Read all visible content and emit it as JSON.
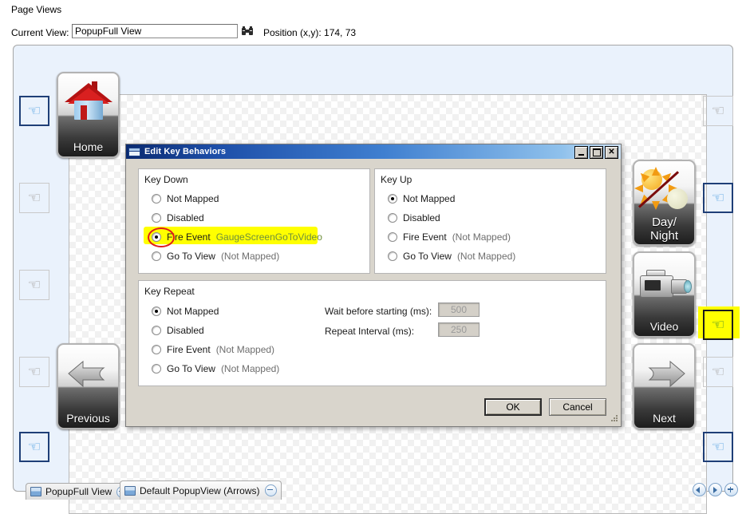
{
  "header": {
    "section_title": "Page Views",
    "current_view_label": "Current View:",
    "current_view_value": "PopupFull View",
    "current_view_placeholder": "",
    "binoculars_icon": "binoculars-icon",
    "position_label": "Position (x,y): 174, 73"
  },
  "canvas_buttons": {
    "home": {
      "label": "Home",
      "icon": "house-icon"
    },
    "previous": {
      "label": "Previous",
      "icon": "arrow-left-icon"
    },
    "day_night": {
      "label_line1": "Day/",
      "label_line2": "Night",
      "icon": "sun-moon-icon"
    },
    "video": {
      "label": "Video",
      "icon": "camcorder-icon"
    },
    "next": {
      "label": "Next",
      "icon": "arrow-right-icon"
    }
  },
  "hotspots": {
    "icon": "hand-pointer-icon",
    "left": [
      {
        "state": "selected"
      },
      {
        "state": "normal"
      },
      {
        "state": "normal"
      },
      {
        "state": "normal"
      },
      {
        "state": "selected"
      }
    ],
    "right": [
      {
        "state": "normal"
      },
      {
        "state": "selected"
      },
      {
        "state": "highlighted"
      },
      {
        "state": "normal"
      },
      {
        "state": "selected"
      }
    ]
  },
  "dialog": {
    "title": "Edit Key Behaviors",
    "title_icon": "window-icon",
    "window_buttons": {
      "minimize": "_",
      "maximize": "□",
      "close": "✕"
    },
    "key_down": {
      "legend": "Key Down",
      "options": [
        {
          "label": "Not Mapped",
          "sub": "",
          "selected": false,
          "highlighted": false
        },
        {
          "label": "Disabled",
          "sub": "",
          "selected": false,
          "highlighted": false
        },
        {
          "label": "Fire Event",
          "sub": "GaugeScreenGoToVideo",
          "selected": true,
          "highlighted": true
        },
        {
          "label": "Go To View",
          "sub": "(Not Mapped)",
          "selected": false,
          "highlighted": false
        }
      ]
    },
    "key_up": {
      "legend": "Key Up",
      "options": [
        {
          "label": "Not Mapped",
          "sub": "",
          "selected": true,
          "highlighted": false
        },
        {
          "label": "Disabled",
          "sub": "",
          "selected": false,
          "highlighted": false
        },
        {
          "label": "Fire Event",
          "sub": "(Not Mapped)",
          "selected": false,
          "highlighted": false
        },
        {
          "label": "Go To View",
          "sub": "(Not Mapped)",
          "selected": false,
          "highlighted": false
        }
      ]
    },
    "key_repeat": {
      "legend": "Key Repeat",
      "options": [
        {
          "label": "Not Mapped",
          "sub": "",
          "selected": true
        },
        {
          "label": "Disabled",
          "sub": "",
          "selected": false
        },
        {
          "label": "Fire Event",
          "sub": "(Not Mapped)",
          "selected": false
        },
        {
          "label": "Go To View",
          "sub": "(Not Mapped)",
          "selected": false
        }
      ],
      "wait_label": "Wait before starting (ms):",
      "wait_value": "500",
      "interval_label": "Repeat Interval (ms):",
      "interval_value": "250"
    },
    "ok_label": "OK",
    "cancel_label": "Cancel"
  },
  "tabs": [
    {
      "label": "PopupFull View",
      "active": false
    },
    {
      "label": "Default PopupView (Arrows)",
      "active": true
    }
  ],
  "nav": {
    "prev_icon": "arrow-left-circle-icon",
    "next_icon": "arrow-right-circle-icon",
    "add_icon": "plus-circle-icon"
  },
  "colors": {
    "panel_bg": "#eaf2fc",
    "dialog_bg": "#d9d5cc",
    "titlebar_start": "#0a2a70",
    "titlebar_end": "#cfe4f7",
    "highlight_yellow": "#ffff00",
    "annotation_red": "#e01b1b",
    "event_text_green": "#6e8f3c"
  }
}
